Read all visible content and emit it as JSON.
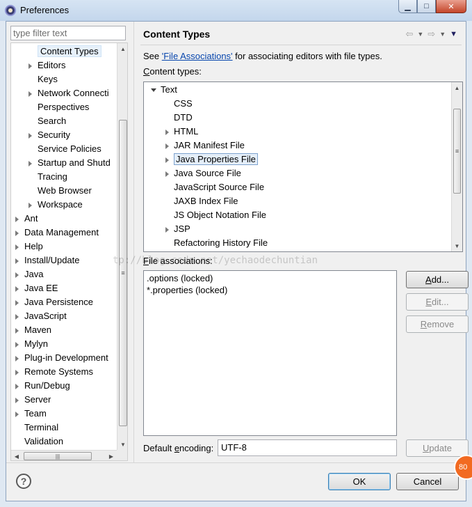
{
  "window": {
    "title": "Preferences",
    "minimize_glyph": "▁",
    "maximize_glyph": "□",
    "close_glyph": "✕"
  },
  "filter": {
    "placeholder": "type filter text"
  },
  "tree": {
    "items": [
      {
        "label": "Content Types",
        "indent": 2,
        "expander": "none",
        "selected": true
      },
      {
        "label": "Editors",
        "indent": 2,
        "expander": "closed"
      },
      {
        "label": "Keys",
        "indent": 2,
        "expander": "none"
      },
      {
        "label": "Network Connecti",
        "indent": 2,
        "expander": "closed"
      },
      {
        "label": "Perspectives",
        "indent": 2,
        "expander": "none"
      },
      {
        "label": "Search",
        "indent": 2,
        "expander": "none"
      },
      {
        "label": "Security",
        "indent": 2,
        "expander": "closed"
      },
      {
        "label": "Service Policies",
        "indent": 2,
        "expander": "none"
      },
      {
        "label": "Startup and Shutd",
        "indent": 2,
        "expander": "closed"
      },
      {
        "label": "Tracing",
        "indent": 2,
        "expander": "none"
      },
      {
        "label": "Web Browser",
        "indent": 2,
        "expander": "none"
      },
      {
        "label": "Workspace",
        "indent": 2,
        "expander": "closed"
      },
      {
        "label": "Ant",
        "indent": 1,
        "expander": "closed"
      },
      {
        "label": "Data Management",
        "indent": 1,
        "expander": "closed"
      },
      {
        "label": "Help",
        "indent": 1,
        "expander": "closed"
      },
      {
        "label": "Install/Update",
        "indent": 1,
        "expander": "closed"
      },
      {
        "label": "Java",
        "indent": 1,
        "expander": "closed"
      },
      {
        "label": "Java EE",
        "indent": 1,
        "expander": "closed"
      },
      {
        "label": "Java Persistence",
        "indent": 1,
        "expander": "closed"
      },
      {
        "label": "JavaScript",
        "indent": 1,
        "expander": "closed"
      },
      {
        "label": "Maven",
        "indent": 1,
        "expander": "closed"
      },
      {
        "label": "Mylyn",
        "indent": 1,
        "expander": "closed"
      },
      {
        "label": "Plug-in Development",
        "indent": 1,
        "expander": "closed"
      },
      {
        "label": "Remote Systems",
        "indent": 1,
        "expander": "closed"
      },
      {
        "label": "Run/Debug",
        "indent": 1,
        "expander": "closed"
      },
      {
        "label": "Server",
        "indent": 1,
        "expander": "closed"
      },
      {
        "label": "Team",
        "indent": 1,
        "expander": "closed"
      },
      {
        "label": "Terminal",
        "indent": 1,
        "expander": "none"
      },
      {
        "label": "Validation",
        "indent": 1,
        "expander": "none"
      }
    ]
  },
  "page": {
    "title": "Content Types",
    "see_prefix": "See ",
    "see_link": "'File Associations'",
    "see_suffix": " for associating editors with file types.",
    "content_types_label_u": "C",
    "content_types_label_rest": "ontent types:",
    "content_types": [
      {
        "label": "Text",
        "indent": 0,
        "expander": "open"
      },
      {
        "label": "CSS",
        "indent": 1,
        "expander": "none"
      },
      {
        "label": "DTD",
        "indent": 1,
        "expander": "none"
      },
      {
        "label": "HTML",
        "indent": 1,
        "expander": "closed"
      },
      {
        "label": "JAR Manifest File",
        "indent": 1,
        "expander": "closed"
      },
      {
        "label": "Java Properties File",
        "indent": 1,
        "expander": "closed",
        "selected": true
      },
      {
        "label": "Java Source File",
        "indent": 1,
        "expander": "closed"
      },
      {
        "label": "JavaScript Source File",
        "indent": 1,
        "expander": "none"
      },
      {
        "label": "JAXB Index File",
        "indent": 1,
        "expander": "none"
      },
      {
        "label": "JS Object Notation File",
        "indent": 1,
        "expander": "none"
      },
      {
        "label": "JSP",
        "indent": 1,
        "expander": "closed"
      },
      {
        "label": "Refactoring History File",
        "indent": 1,
        "expander": "none"
      }
    ],
    "file_assoc_label_u": "F",
    "file_assoc_label_rest": "ile associations:",
    "file_associations": [
      ".options (locked)",
      "*.properties (locked)"
    ],
    "buttons": {
      "add_u": "A",
      "add_rest": "dd...",
      "edit_u": "E",
      "edit_rest": "dit...",
      "remove_u": "R",
      "remove_rest": "emove"
    },
    "encoding_label_pre": "Default ",
    "encoding_label_u": "e",
    "encoding_label_rest": "ncoding:",
    "encoding_value": "UTF-8",
    "update_u": "U",
    "update_rest": "pdate"
  },
  "nav": {
    "back_glyph": "⇦",
    "forward_glyph": "⇨",
    "dropdown_glyph": "▼",
    "menu_glyph": "▼"
  },
  "footer": {
    "help_glyph": "?",
    "ok_label": "OK",
    "cancel_label": "Cancel",
    "badge_text": "80"
  },
  "watermark": "tp://blog.csdn.net/yechaodechuntian"
}
